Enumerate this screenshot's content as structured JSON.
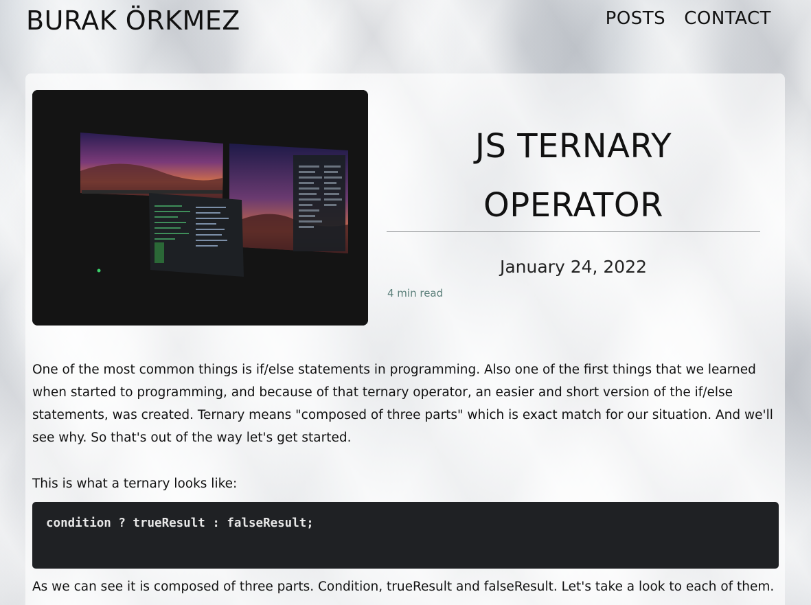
{
  "site": {
    "brand": "BURAK ÖRKMEZ",
    "nav": [
      {
        "label": "POSTS"
      },
      {
        "label": "CONTACT"
      }
    ]
  },
  "post": {
    "title_line1": "JS TERNARY",
    "title_line2": "OPERATOR",
    "date": "January 24, 2022",
    "read_time": "4 min read",
    "paragraph1": "One of the most common things is if/else statements in programming. Also one of the first things that we learned when started to programming, and because of that ternary operator, an easier and short version of the if/else statements, was created. Ternary means \"composed of three parts\" which is exact match for our situation. And we'll see why. So that's out of the way let's get started.",
    "paragraph2": "This is what a ternary looks like:",
    "code": "condition ? trueResult : falseResult;",
    "paragraph3": "As we can see it is composed of three parts. Condition, trueResult and falseResult. Let's take a look to each of them."
  },
  "colors": {
    "code_bg": "#1f2124",
    "read_time": "#5b7f7a"
  },
  "icons": {
    "hero": "desk-setup-photo"
  }
}
